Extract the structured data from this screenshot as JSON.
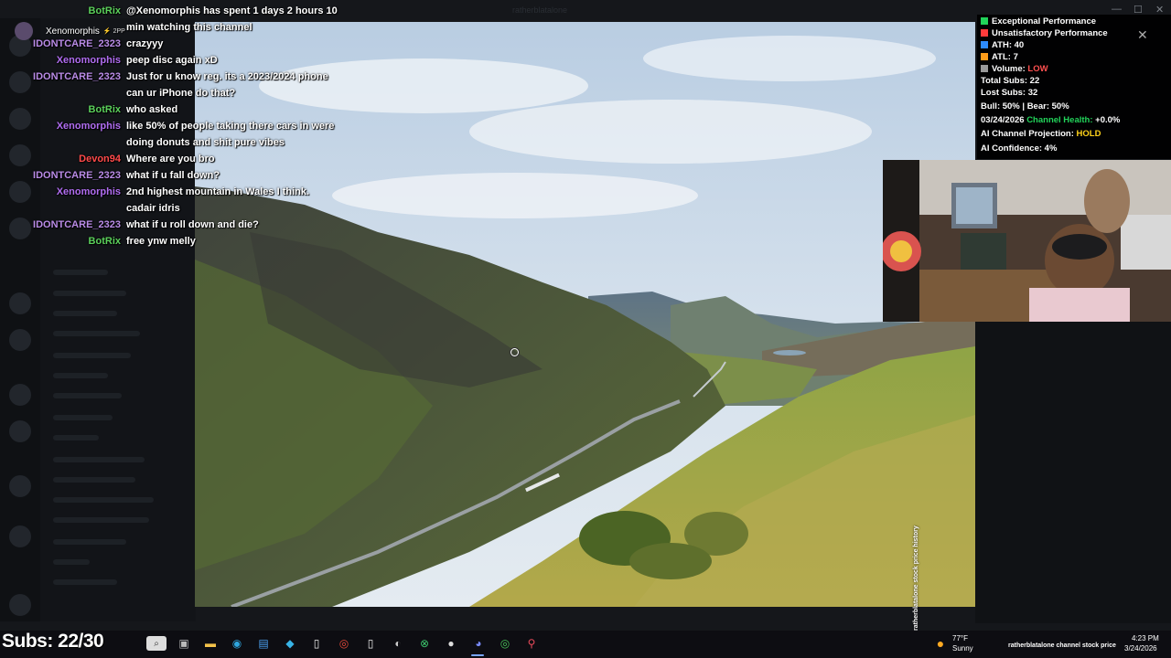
{
  "window": {
    "title": "ratherblatalone"
  },
  "chat": {
    "top_user": {
      "name": "Xenomorphis",
      "badge": "⚡ 2PP"
    },
    "messages": [
      {
        "user": "BotRix",
        "color": "#5bd05b",
        "text": "@Xenomorphis has spent 1 days 2 hours 10 min watching this channel"
      },
      {
        "user": "IDONTCARE_2323",
        "color": "#b98be6",
        "text": "crazyyy"
      },
      {
        "user": "Xenomorphis",
        "color": "#b06df0",
        "text": "peep disc again xD"
      },
      {
        "user": "IDONTCARE_2323",
        "color": "#b98be6",
        "text": "Just for u know reg. its a 2023/2024 phone can ur iPhone do that?"
      },
      {
        "user": "BotRix",
        "color": "#5bd05b",
        "text": "who asked"
      },
      {
        "user": "Xenomorphis",
        "color": "#b06df0",
        "text": "like 50% of people taking there cars in were doing donuts and shit pure vibes"
      },
      {
        "user": "Devon94",
        "color": "#ff4a4a",
        "text": "Where are you bro"
      },
      {
        "user": "IDONTCARE_2323",
        "color": "#b98be6",
        "text": "what if u fall down?"
      },
      {
        "user": "Xenomorphis",
        "color": "#b06df0",
        "text": "2nd highest mountain in Wales I think. cadair idris"
      },
      {
        "user": "IDONTCARE_2323",
        "color": "#b98be6",
        "text": "what if u roll down and die?"
      },
      {
        "user": "BotRix",
        "color": "#5bd05b",
        "text": "free ynw melly"
      }
    ]
  },
  "stats": {
    "legend_exceptional": "Exceptional Performance",
    "legend_unsatisfactory": "Unsatisfactory Performance",
    "ath": "ATH: 40",
    "atl": "ATL: 7",
    "volume_label": "Volume: ",
    "volume_value": "LOW",
    "total_subs": "Total Subs: 22",
    "lost_subs": "Lost Subs: 32",
    "bull_bear": "Bull: 50% | Bear: 50%",
    "health_date": "03/24/2026 ",
    "health_label": "Channel Health: ",
    "health_value": "+0.0%",
    "projection_label": "AI Channel Projection: ",
    "projection_value": "HOLD",
    "confidence": "AI Confidence: 4%",
    "colors": {
      "exceptional": "#22d35a",
      "unsatisfactory": "#ff3b3b",
      "ath": "#2d8cff",
      "atl": "#ff9d1a",
      "volume": "#9a9a9a",
      "low": "#ff5050",
      "health": "#22d35a",
      "hold": "#ffd21a"
    }
  },
  "overlay": {
    "vertical_caption": "ratherblatalone stock price history"
  },
  "taskbar": {
    "subs_text": "Subs: 22/30",
    "search_placeholder": "Search",
    "weather_temp": "77°F",
    "weather_cond": "Sunny",
    "ticker": "ratherblatalone channel stock price",
    "time": "4:23 PM",
    "date": "3/24/2026",
    "icons": [
      "task-view-icon",
      "file-explorer-icon",
      "edge-icon",
      "store-icon",
      "app-icon",
      "file-icon",
      "chrome-icon",
      "obs-icon",
      "xbox-icon",
      "steam-icon",
      "discord-icon",
      "chrome-alt-icon",
      "maps-icon"
    ]
  }
}
